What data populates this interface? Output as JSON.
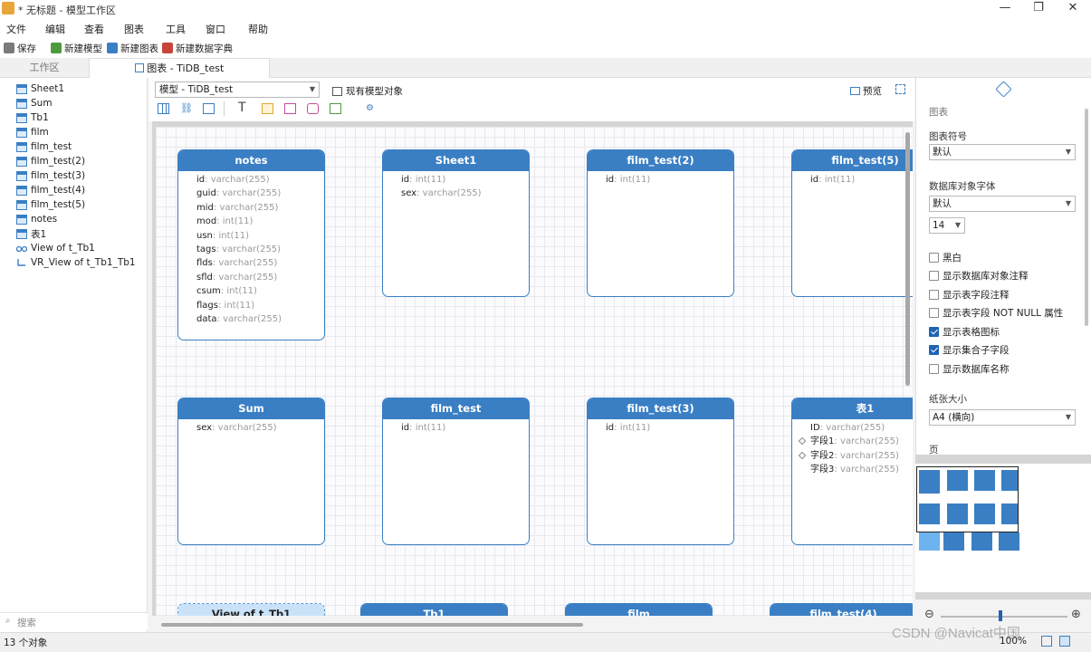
{
  "window": {
    "title": "* 无标题 - 模型工作区",
    "minimize": "—",
    "maximize": "❐",
    "close": "✕"
  },
  "menu": [
    "文件",
    "编辑",
    "查看",
    "图表",
    "工具",
    "窗口",
    "帮助"
  ],
  "toolbar": {
    "save": "保存",
    "new_model": "新建模型",
    "new_diagram": "新建图表",
    "new_dictionary": "新建数据字典"
  },
  "tabs": {
    "workspace": "工作区",
    "diagram": "图表 - TiDB_test"
  },
  "sidebar": {
    "items": [
      {
        "label": "Sheet1",
        "icon": "table-icon"
      },
      {
        "label": "Sum",
        "icon": "table-icon"
      },
      {
        "label": "Tb1",
        "icon": "table-icon"
      },
      {
        "label": "film",
        "icon": "table-icon"
      },
      {
        "label": "film_test",
        "icon": "table-icon"
      },
      {
        "label": "film_test(2)",
        "icon": "table-icon"
      },
      {
        "label": "film_test(3)",
        "icon": "table-icon"
      },
      {
        "label": "film_test(4)",
        "icon": "table-icon"
      },
      {
        "label": "film_test(5)",
        "icon": "table-icon"
      },
      {
        "label": "notes",
        "icon": "table-icon"
      },
      {
        "label": "表1",
        "icon": "table-icon"
      },
      {
        "label": "View of t_Tb1",
        "icon": "view-icon"
      },
      {
        "label": "VR_View of t_Tb1_Tb1",
        "icon": "vr-view-icon"
      }
    ],
    "search_placeholder": "搜索"
  },
  "editor": {
    "model_select": "模型 - TiDB_test",
    "existing_objects": "现有模型对象",
    "preview": "预览"
  },
  "entities": [
    {
      "name": "notes",
      "fields": [
        [
          "id",
          "varchar(255)"
        ],
        [
          "guid",
          "varchar(255)"
        ],
        [
          "mid",
          "varchar(255)"
        ],
        [
          "mod",
          "int(11)"
        ],
        [
          "usn",
          "int(11)"
        ],
        [
          "tags",
          "varchar(255)"
        ],
        [
          "flds",
          "varchar(255)"
        ],
        [
          "sfld",
          "varchar(255)"
        ],
        [
          "csum",
          "int(11)"
        ],
        [
          "flags",
          "int(11)"
        ],
        [
          "data",
          "varchar(255)"
        ]
      ]
    },
    {
      "name": "Sheet1",
      "fields": [
        [
          "id",
          "int(11)"
        ],
        [
          "sex",
          "varchar(255)"
        ]
      ]
    },
    {
      "name": "film_test(2)",
      "fields": [
        [
          "id",
          "int(11)"
        ]
      ]
    },
    {
      "name": "film_test(5)",
      "fields": [
        [
          "id",
          "int(11)"
        ]
      ]
    },
    {
      "name": "Sum",
      "fields": [
        [
          "sex",
          "varchar(255)"
        ]
      ]
    },
    {
      "name": "film_test",
      "fields": [
        [
          "id",
          "int(11)"
        ]
      ]
    },
    {
      "name": "film_test(3)",
      "fields": [
        [
          "id",
          "int(11)"
        ]
      ]
    },
    {
      "name": "表1",
      "fields": [
        [
          "ID",
          "varchar(255)"
        ],
        [
          "字段1",
          "varchar(255)"
        ],
        [
          "字段2",
          "varchar(255)"
        ],
        [
          "字段3",
          "varchar(255)"
        ]
      ]
    },
    {
      "name": "View of t_Tb1",
      "fields": []
    },
    {
      "name": "Tb1",
      "fields": []
    },
    {
      "name": "film",
      "fields": []
    },
    {
      "name": "film_test(4)",
      "fields": []
    }
  ],
  "properties": {
    "section": "图表",
    "symbol_label": "图表符号",
    "symbol_value": "默认",
    "font_label": "数据库对象字体",
    "font_value": "默认",
    "font_size": "14",
    "checkboxes": [
      {
        "label": "黑白",
        "checked": false
      },
      {
        "label": "显示数据库对象注释",
        "checked": false
      },
      {
        "label": "显示表字段注释",
        "checked": false
      },
      {
        "label": "显示表字段 NOT NULL 属性",
        "checked": false
      },
      {
        "label": "显示表格图标",
        "checked": true
      },
      {
        "label": "显示集合子字段",
        "checked": true
      },
      {
        "label": "显示数据库名称",
        "checked": false
      }
    ],
    "paper_label": "纸张大小",
    "paper_value": "A4 (横向)",
    "page_label": "页"
  },
  "status": {
    "objects": "13 个对象",
    "zoom": "100%"
  },
  "watermark": "CSDN @Navicat中国",
  "colors": {
    "accent": "#3a7fc4",
    "header_text": "#ffffff",
    "view_header": "#c9e2f8"
  }
}
